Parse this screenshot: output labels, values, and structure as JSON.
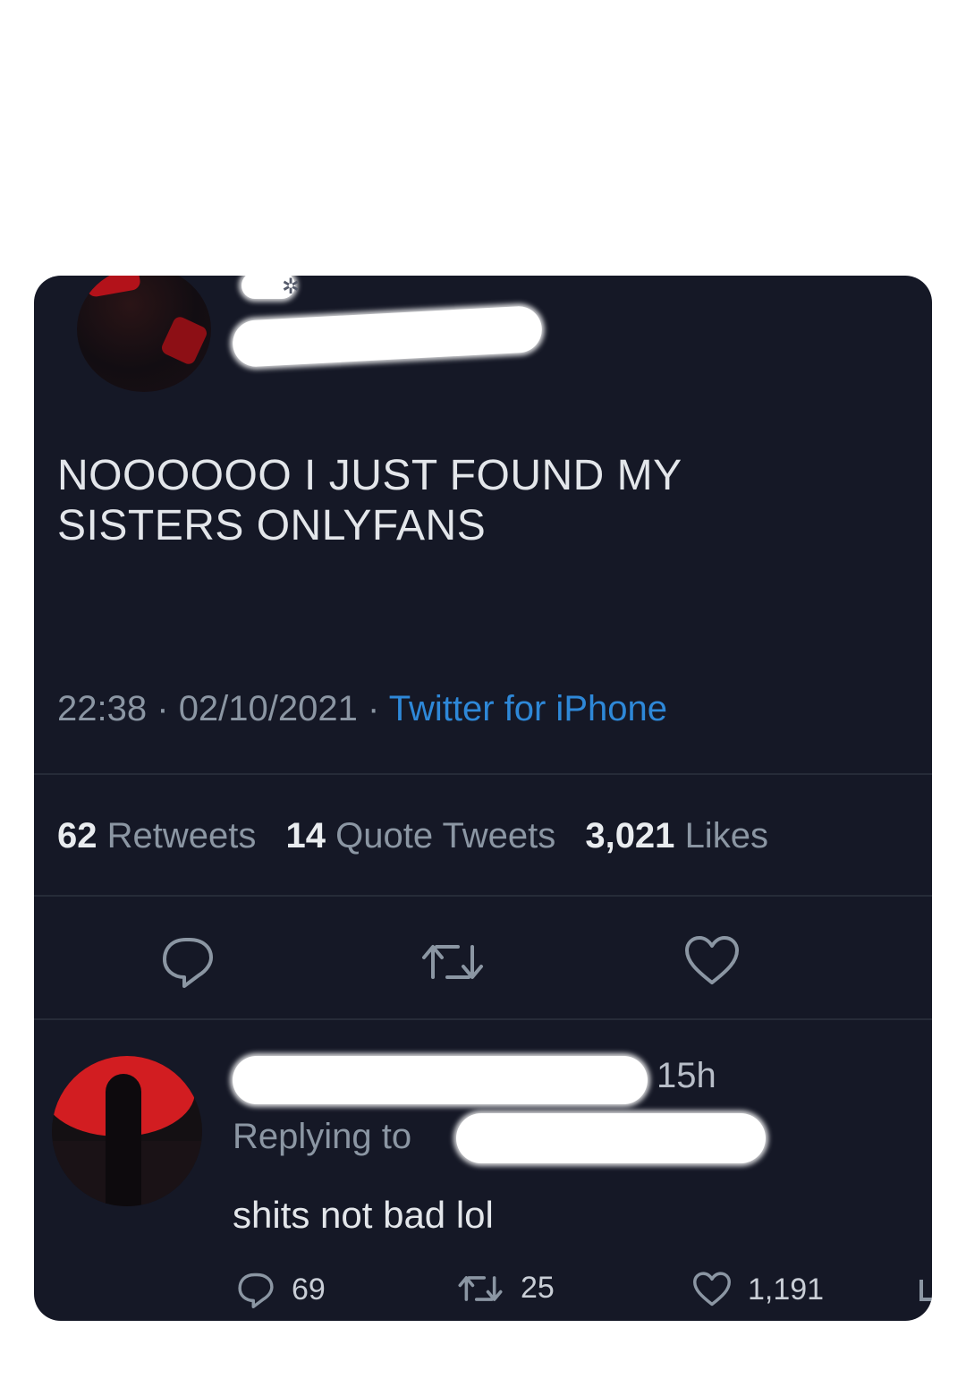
{
  "tweet": {
    "text_line1": "NOOOOOO I JUST FOUND MY",
    "text_line2": "SISTERS ONLYFANS",
    "time": "22:38",
    "date": "02/10/2021",
    "separator": "·",
    "source": "Twitter for iPhone",
    "stats": {
      "retweets_count": "62",
      "retweets_label": "Retweets",
      "quotes_count": "14",
      "quotes_label": "Quote Tweets",
      "likes_count": "3,021",
      "likes_label": "Likes"
    },
    "actions": [
      "reply-icon",
      "retweet-icon",
      "like-icon"
    ]
  },
  "reply": {
    "time": "15h",
    "replying_label": "Replying to",
    "text": "shits not bad lol",
    "reply_count": "69",
    "retweet_count": "25",
    "like_count": "1,191"
  },
  "colors": {
    "background": "#151826",
    "text": "#e3e6ea",
    "muted": "#8b96a3",
    "link": "#2e88d8"
  }
}
